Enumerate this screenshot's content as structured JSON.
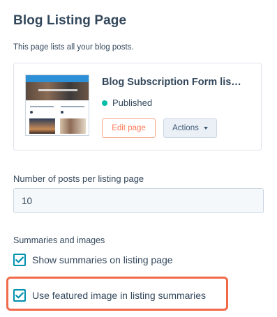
{
  "page": {
    "title": "Blog Listing Page",
    "description": "This page lists all your blog posts."
  },
  "card": {
    "post_title": "Blog Subscription Form lis…",
    "status": "Published",
    "status_color": "#00bda5",
    "edit_label": "Edit page",
    "actions_label": "Actions"
  },
  "posts_per_page": {
    "label": "Number of posts per listing page",
    "value": "10"
  },
  "summaries": {
    "label": "Summaries and images",
    "options": [
      {
        "label": "Show summaries on listing page",
        "checked": true
      },
      {
        "label": "Use featured image in listing summaries",
        "checked": true
      }
    ]
  },
  "colors": {
    "accent": "#0091ae",
    "highlight": "#f06a4a",
    "edit_button": "#ff7a59"
  }
}
